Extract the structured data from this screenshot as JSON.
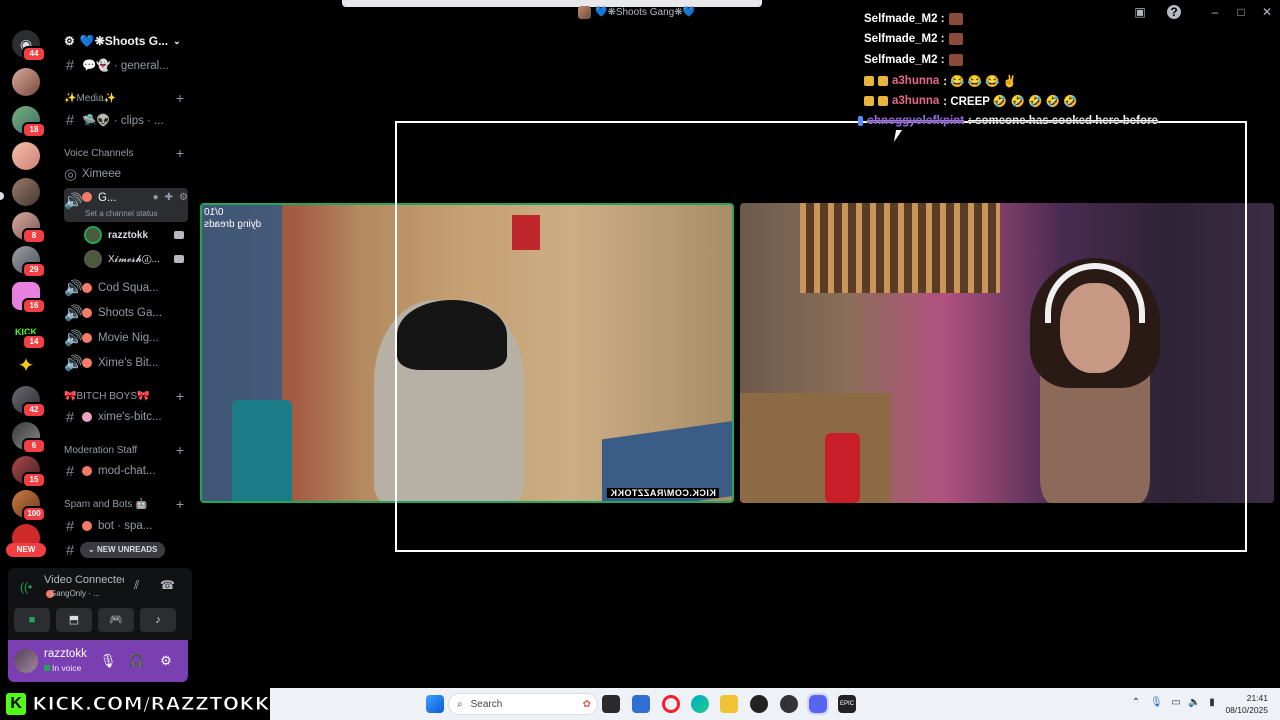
{
  "window": {
    "title": "💙❋Shoots Gang❋💙"
  },
  "colors": {
    "accent_green": "#23a55a",
    "user_panel_purple": "#7a3fb1",
    "badge_red": "#f23f43",
    "kick_green": "#53fc18"
  },
  "rail": {
    "badges": [
      "44",
      "18",
      "8",
      "29",
      "16",
      "14",
      "42",
      "6",
      "15",
      "100"
    ],
    "new_label": "NEW"
  },
  "sidebar": {
    "server_name": "💙❋Shoots G...",
    "general_channel": "💬👻 · general...",
    "media_category": "✨Media✨",
    "clips_channel": "🛸👽 · clips · ...",
    "voice_category": "Voice Channels",
    "ximeee_channel": "Ximeee",
    "active_voice_channel": "G...",
    "channel_status_hint": "Set a channel status",
    "voice_users": [
      "razztokk",
      "X𝓲𝓶𝓮𝓼𝓱ⓓ..."
    ],
    "voice_channels": [
      "Cod Squa...",
      "Shoots Ga...",
      "Movie Nig...",
      "Xime's Bit..."
    ],
    "bitch_boys_category": "🎀BITCH BOYS🎀",
    "xime_bitch_channel": "xime's-bitc...",
    "moderation_category": "Moderation Staff",
    "mod_chat_channel": "mod-chat...",
    "spam_category": "Spam and Bots 🤖",
    "bot_channel": "bot · spa...",
    "new_unreads": "NEW UNREADS"
  },
  "voice_panel": {
    "title": "Video Connected",
    "subtitle": "GangOnly · ..."
  },
  "user_panel": {
    "name": "razztokk",
    "status": "In voice"
  },
  "stage": {
    "left_overlay_lines": [
      "0/10",
      "dying dreads"
    ],
    "kick_tag": "KICK.COM/RAZZTOKK"
  },
  "chat": [
    {
      "user": "Selfmade_M2 :",
      "text": ""
    },
    {
      "user": "Selfmade_M2 :",
      "text": ""
    },
    {
      "user": "Selfmade_M2 :",
      "text": ""
    },
    {
      "user": "a3hunna",
      "text": ": 😂 😂 😂 ✌"
    },
    {
      "user": "a3hunna",
      "text": ": CREEP 🤣 🤣 🤣 🤣 🤣"
    },
    {
      "user": "ohnoggyolofkpint",
      "text": ": someone has cooked here before"
    }
  ],
  "kick_banner": {
    "logo": "K",
    "url": "KICK.COM/RAZZTOKK"
  },
  "taskbar": {
    "search_placeholder": "Search",
    "time": "21:41",
    "date": "08/10/2025"
  },
  "icons": {
    "discord_home": "discord-icon",
    "settings": "gear-icon",
    "mic": "microphone-icon",
    "headset": "headphones-icon",
    "camera": "camera-icon",
    "screen_share": "screen-share-icon",
    "activity": "controller-icon",
    "soundboard": "soundboard-icon",
    "disconnect": "phone-hangup-icon",
    "signal": "signal-icon",
    "noise": "noise-suppression-icon"
  }
}
